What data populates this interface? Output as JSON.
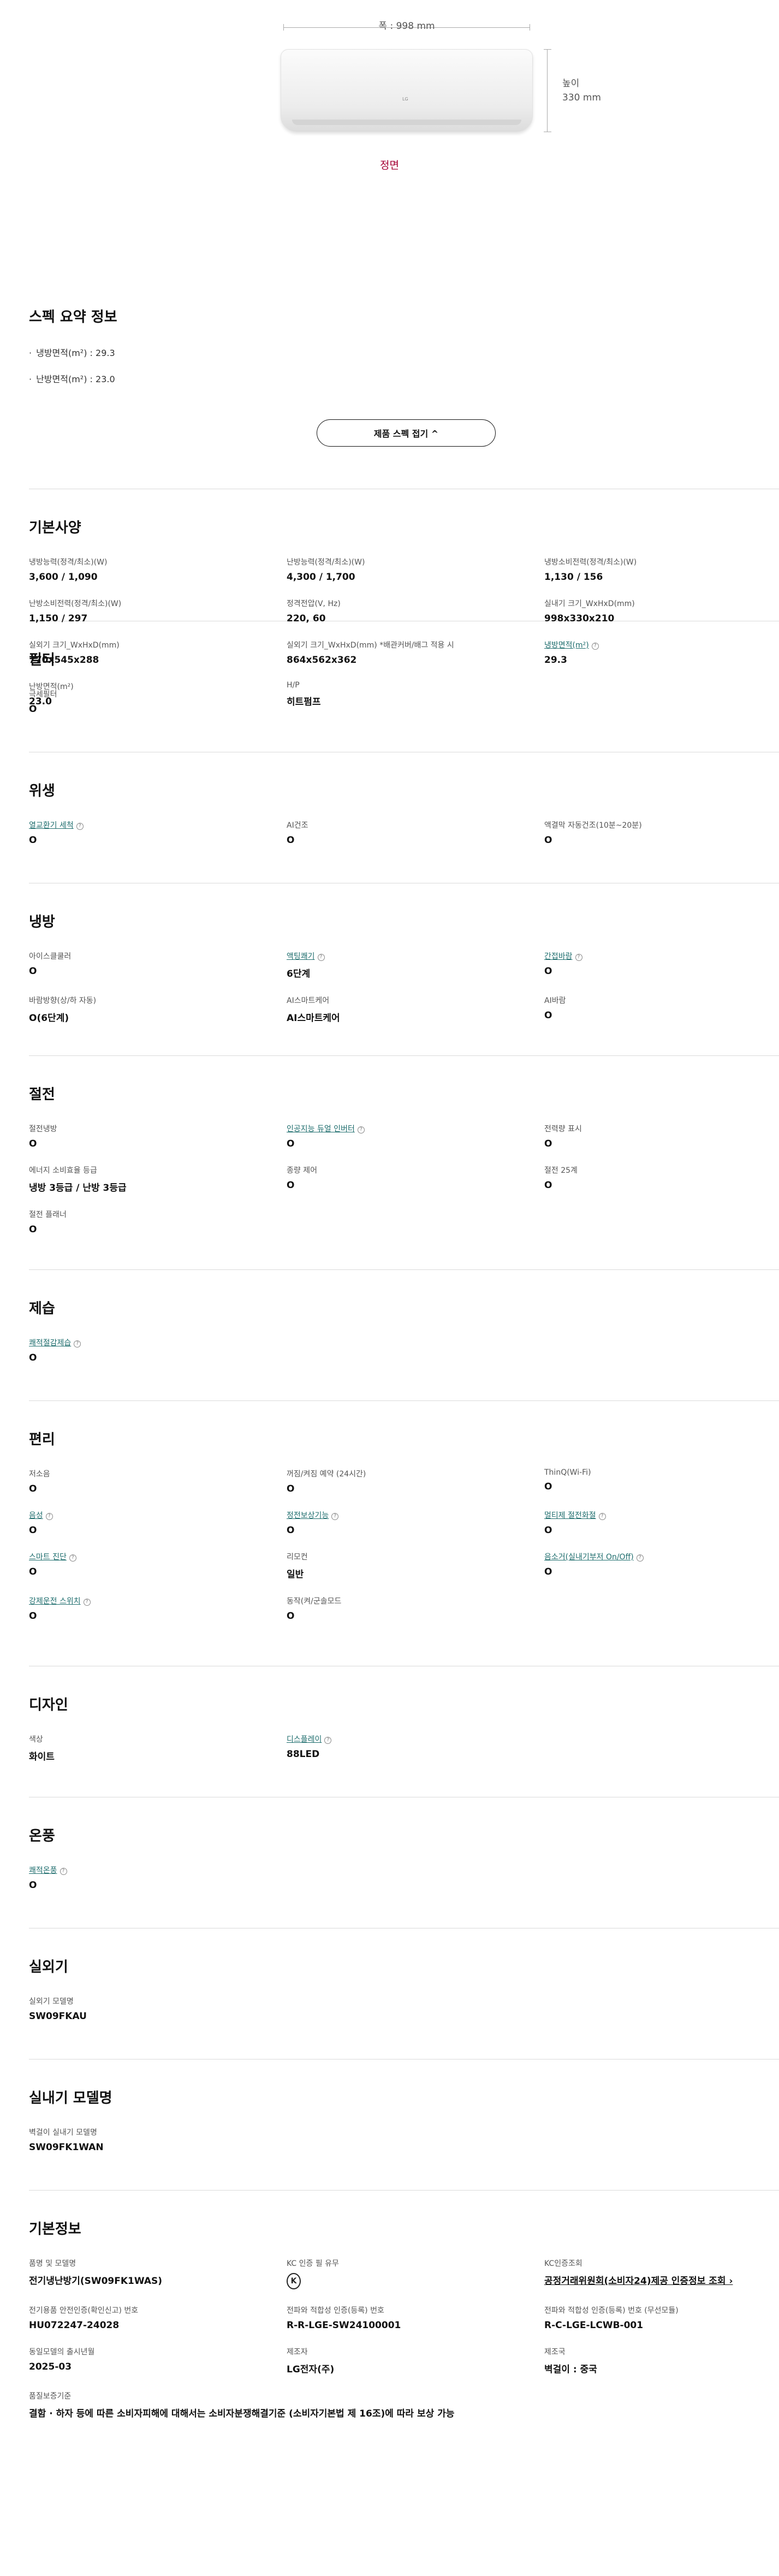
{
  "hero": {
    "width_label": "폭 : 998 mm",
    "height_label_1": "높이",
    "height_label_2": "330 mm",
    "brand_mark": "LG",
    "view_label": "정면"
  },
  "summary": {
    "title": "스펙 요약 정보",
    "items": [
      "냉방면적(m²) : 29.3",
      "난방면적(m²) : 23.0"
    ],
    "fold_button": "제품 스펙 접기 ^"
  },
  "sections": [
    {
      "title": "기본사양",
      "items": [
        {
          "label": "냉방능력(정격/최소)(W)",
          "value": "3,600 / 1,090"
        },
        {
          "label": "난방능력(정격/최소)(W)",
          "value": "4,300 / 1,700"
        },
        {
          "label": "냉방소비전력(정격/최소)(W)",
          "value": "1,130 / 156"
        },
        {
          "label": "난방소비전력(정격/최소)(W)",
          "value": "1,150 / 297"
        },
        {
          "label": "정격전압(V, Hz)",
          "value": "220, 60"
        },
        {
          "label": "실내기 크기_WxHxD(mm)",
          "value": "998x330x210"
        },
        {
          "label": "실외기 크기_WxHxD(mm)",
          "value": "770x545x288"
        },
        {
          "label": "실외기 크기_WxHxD(mm) *배관커버/배그 적용 시",
          "value": "864x562x362"
        },
        {
          "label": "냉방면적(m²)",
          "value": "29.3",
          "link": true
        },
        {
          "label": "난방면적(m²)",
          "value": "23.0"
        },
        {
          "label": "H/P",
          "value": "히트펌프"
        }
      ]
    },
    {
      "title": "필터",
      "items": [
        {
          "label": "극세필터",
          "value": "O"
        }
      ]
    },
    {
      "title": "위생",
      "items": [
        {
          "label": "열교환기 세척",
          "value": "O",
          "link": true
        },
        {
          "label": "AI건조",
          "value": "O"
        },
        {
          "label": "액결막 자동건조(10분~20분)",
          "value": "O"
        }
      ]
    },
    {
      "title": "냉방",
      "items": [
        {
          "label": "아이스클쿨러",
          "value": "O"
        },
        {
          "label": "액팅쾌기",
          "value": "6단계",
          "link": true
        },
        {
          "label": "간접바람",
          "value": "O",
          "link": true
        },
        {
          "label": "바람방향(상/하 자동)",
          "value": "O(6단계)"
        },
        {
          "label": "AI스마트케어",
          "value": "AI스마트케어"
        },
        {
          "label": "AI바람",
          "value": "O"
        }
      ]
    },
    {
      "title": "절전",
      "items": [
        {
          "label": "절전냉방",
          "value": "O"
        },
        {
          "label": "인공지능 듀얼 인버터",
          "value": "O",
          "link": true
        },
        {
          "label": "전력량 표시",
          "value": "O"
        },
        {
          "label": "에너지 소비효율 등급",
          "value": "냉방 3등급 / 난방 3등급"
        },
        {
          "label": "종량 제어",
          "value": "O"
        },
        {
          "label": "절전 25계",
          "value": "O"
        },
        {
          "label": "절전 플래너",
          "value": "O"
        }
      ]
    },
    {
      "title": "제습",
      "items": [
        {
          "label": "쾌적절감제습",
          "value": "O",
          "link": true
        }
      ]
    },
    {
      "title": "편리",
      "items": [
        {
          "label": "저소음",
          "value": "O"
        },
        {
          "label": "꺼짐/켜짐 예약 (24시간)",
          "value": "O"
        },
        {
          "label": "ThinQ(Wi-Fi)",
          "value": "O"
        },
        {
          "label": "음성",
          "value": "O",
          "link": true
        },
        {
          "label": "정전보상기능",
          "value": "O",
          "link": true
        },
        {
          "label": "멀티제 절전화절",
          "value": "O",
          "link": true
        },
        {
          "label": "스마트 진단",
          "value": "O",
          "link": true
        },
        {
          "label": "리모컨",
          "value": "일반"
        },
        {
          "label": "음소거(실내기부저 On/Off)",
          "value": "O",
          "link": true
        },
        {
          "label": "강제운전 스위치",
          "value": "O",
          "link": true
        },
        {
          "label": "동작(켜/군솔모드",
          "value": "O"
        }
      ]
    },
    {
      "title": "디자인",
      "items": [
        {
          "label": "색상",
          "value": "화이트"
        },
        {
          "label": "디스플레이",
          "value": "88LED",
          "link": true
        }
      ]
    },
    {
      "title": "온풍",
      "items": [
        {
          "label": "쾌적온풍",
          "value": "O",
          "link": true
        }
      ]
    },
    {
      "title": "실외기",
      "items": [
        {
          "label": "실외기 모델명",
          "value": "SW09FKAU"
        }
      ]
    },
    {
      "title": "실내기 모델명",
      "items": [
        {
          "label": "벽걸이 실내기 모델명",
          "value": "SW09FK1WAN"
        }
      ]
    },
    {
      "title": "기본정보",
      "items": [
        {
          "label": "품명 및 모델명",
          "value": "전기냉난방기(SW09FK1WAS)"
        },
        {
          "label": "KC 인증 필 유무",
          "value": "K",
          "kc": true
        },
        {
          "label": "KC인증조회",
          "value": "공정거래위원회(소비자24)제공 인증정보 조회 ›",
          "valueLink": true
        },
        {
          "label": "전기용품 안전인증(확인신고) 번호",
          "value": "HU072247-24028"
        },
        {
          "label": "전파와 적합성 인증(등록) 번호",
          "value": "R-R-LGE-SW24100001"
        },
        {
          "label": "전파와 적합성 인증(등록) 번호 (무선모듈)",
          "value": "R-C-LGE-LCWB-001"
        },
        {
          "label": "동일모델의 출시년월",
          "value": "2025-03"
        },
        {
          "label": "제조자",
          "value": "LG전자(주)"
        },
        {
          "label": "제조국",
          "value": "벽걸이 : 중국"
        },
        {
          "label": "품질보증기준",
          "value": "결함 · 하자 등에 따른 소비자피해에 대해서는 소비자분쟁해결기준 (소비자기본법 제 16조)에 따라 보상 가능",
          "wide": true
        }
      ]
    }
  ]
}
